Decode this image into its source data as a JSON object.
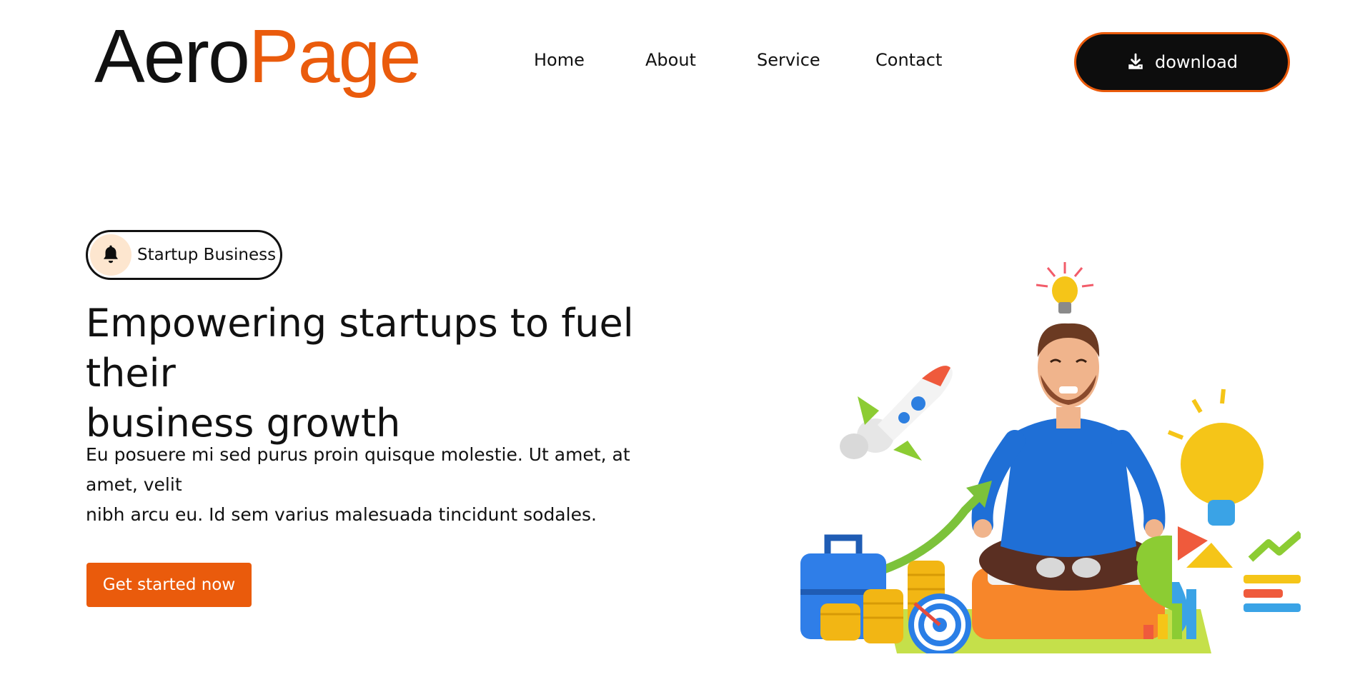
{
  "header": {
    "logo_part1": "Aero",
    "logo_part2": "Page",
    "nav": [
      "Home",
      "About",
      "Service",
      "Contact"
    ],
    "download_label": "download"
  },
  "hero": {
    "badge_label": "Startup Business",
    "title_line1": "Empowering startups to fuel their",
    "title_line2": "business growth",
    "text_line1": "Eu posuere mi sed purus proin quisque molestie. Ut amet, at amet, velit",
    "text_line2": "nibh arcu eu. Id sem varius malesuada tincidunt sodales.",
    "cta_label": "Get started now"
  },
  "icons": {
    "download": "download-icon",
    "bell": "bell-icon"
  },
  "colors": {
    "accent": "#ea5b0c",
    "dark": "#0d0d0d",
    "badge_bg": "#fde6cf",
    "text": "#111111"
  }
}
